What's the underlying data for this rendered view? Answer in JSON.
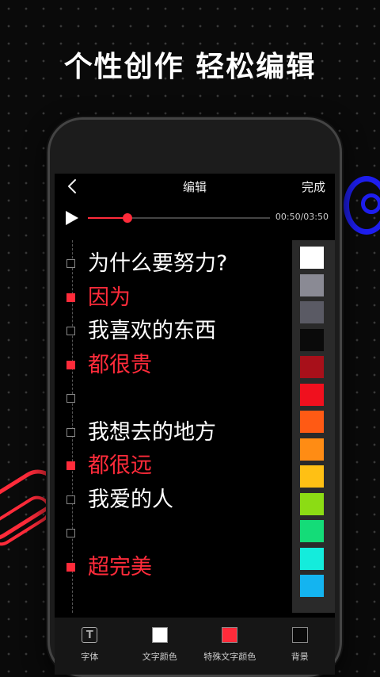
{
  "headline": "个性创作 轻松编辑",
  "header": {
    "title": "编辑",
    "done_label": "完成"
  },
  "player": {
    "time": "00:50/03:50",
    "progress_fraction": 0.2174
  },
  "lyrics": [
    {
      "text": "为什么要努力?",
      "special": false
    },
    {
      "text": "因为",
      "special": true
    },
    {
      "text": "我喜欢的东西",
      "special": false
    },
    {
      "text": "都很贵",
      "special": true
    },
    {
      "text": "",
      "special": false
    },
    {
      "text": "我想去的地方",
      "special": false
    },
    {
      "text": "都很远",
      "special": true
    },
    {
      "text": "我爱的人",
      "special": false
    },
    {
      "text": "",
      "special": false
    },
    {
      "text": "超完美",
      "special": true
    }
  ],
  "palette": {
    "selected_index": 0,
    "colors": [
      "#ffffff",
      "#8a8a94",
      "#5a5a64",
      "#0a0a0a",
      "#a8101a",
      "#f0101e",
      "#ff5a14",
      "#ff8c14",
      "#ffc014",
      "#8cdc14",
      "#14dc78",
      "#14ecdc",
      "#14b4f0"
    ]
  },
  "toolbar": {
    "items": [
      {
        "label": "字体",
        "icon": "font-icon",
        "glyph": "T"
      },
      {
        "label": "文字颜色",
        "icon": "text-color-icon",
        "color": "#ffffff"
      },
      {
        "label": "特殊文字颜色",
        "icon": "special-text-color-icon",
        "color": "#ff2b3a"
      },
      {
        "label": "背景",
        "icon": "background-icon",
        "color": "#0a0a0a"
      }
    ]
  },
  "accent": "#ff2b3a"
}
